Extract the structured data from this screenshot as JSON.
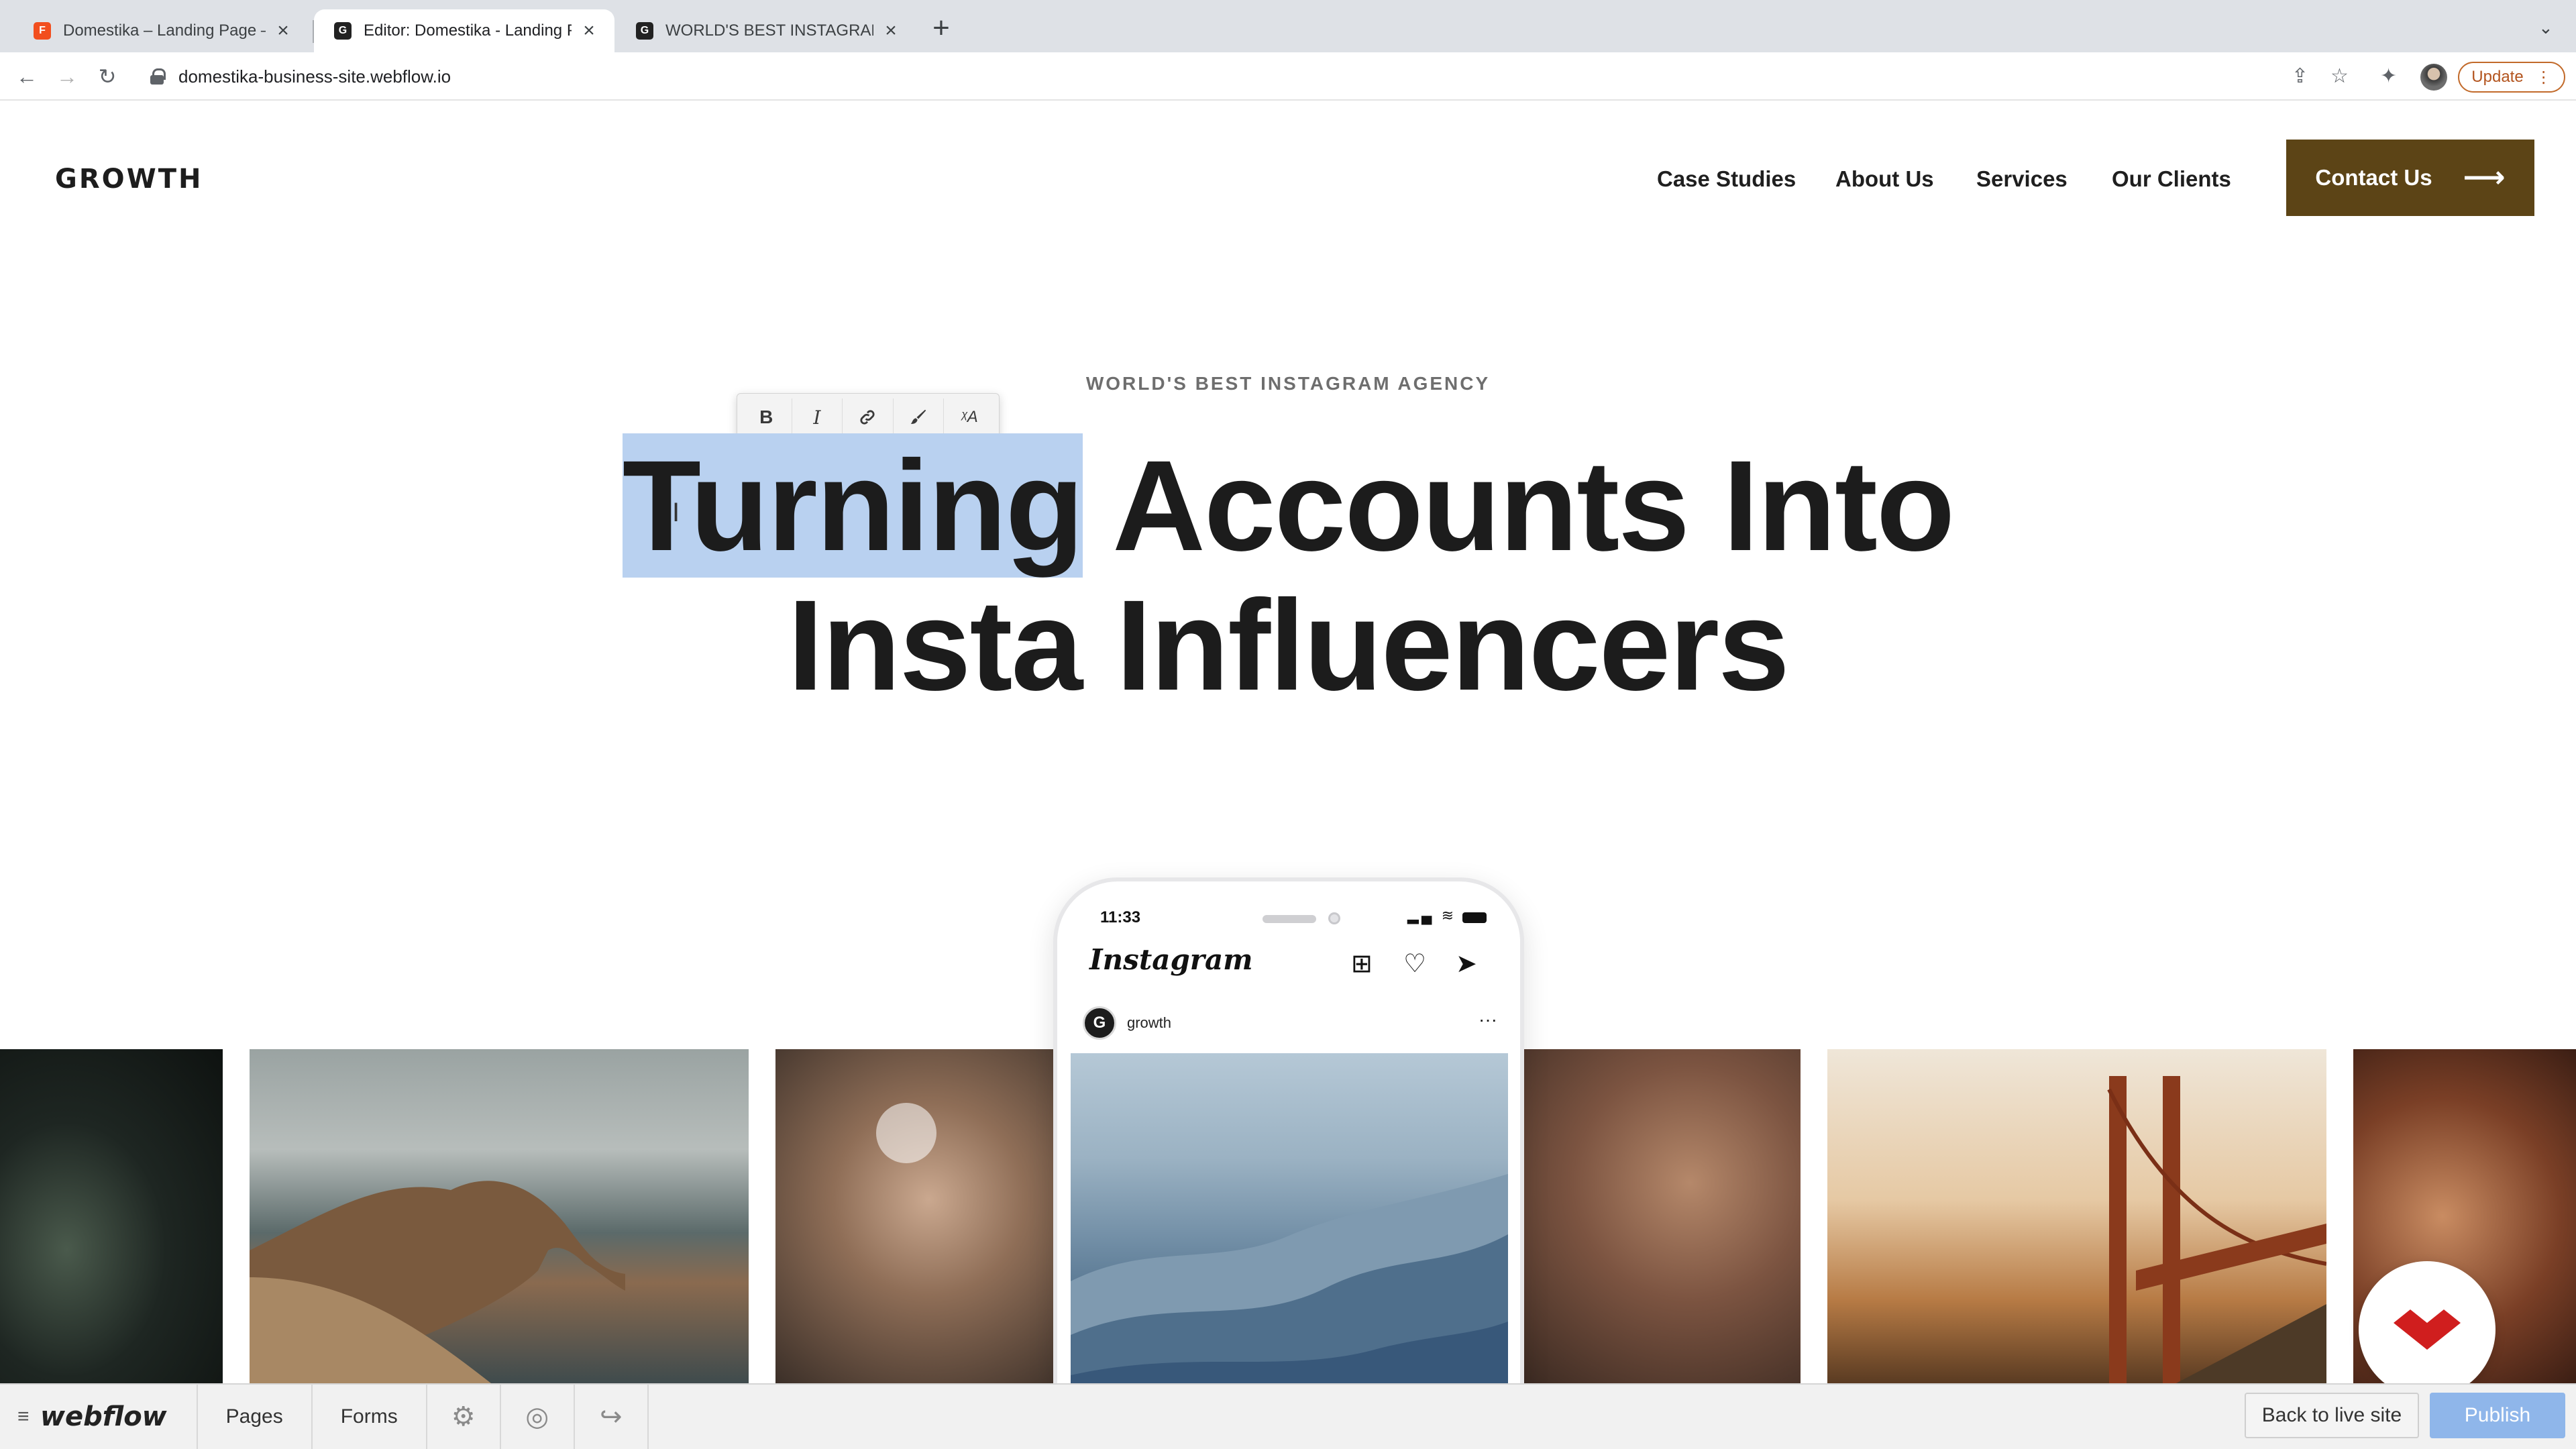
{
  "browser": {
    "tabs": [
      {
        "title": "Domestika – Landing Page – Fi",
        "active": false
      },
      {
        "title": "Editor: Domestika - Landing Pa",
        "active": true
      },
      {
        "title": "WORLD'S BEST INSTAGRAM A",
        "active": false
      }
    ],
    "new_tab": "+",
    "url": "domestika-business-site.webflow.io",
    "update_label": "Update"
  },
  "site": {
    "logo": "GROWTH",
    "nav": [
      "Case Studies",
      "About Us",
      "Services",
      "Our Clients"
    ],
    "contact_label": "Contact Us",
    "eyebrow": "WORLD'S BEST INSTAGRAM AGENCY",
    "headline_selected": "Turning",
    "headline_rest_line1": " Accounts Into",
    "headline_line2": "Insta Influencers"
  },
  "format_toolbar": {
    "buttons": [
      "B",
      "I",
      "link",
      "brush",
      "clear-format"
    ]
  },
  "phone": {
    "time": "11:33",
    "app_name": "Instagram",
    "username": "growth",
    "avatar_letter": "G"
  },
  "editor": {
    "logo": "webflow",
    "pages_label": "Pages",
    "forms_label": "Forms",
    "back_label": "Back to live site",
    "publish_label": "Publish"
  },
  "colors": {
    "contact_bg": "#5c4416",
    "selection": "#b9d1f0",
    "publish_bg": "#8fb6ea",
    "badge_red": "#d01e1e"
  }
}
